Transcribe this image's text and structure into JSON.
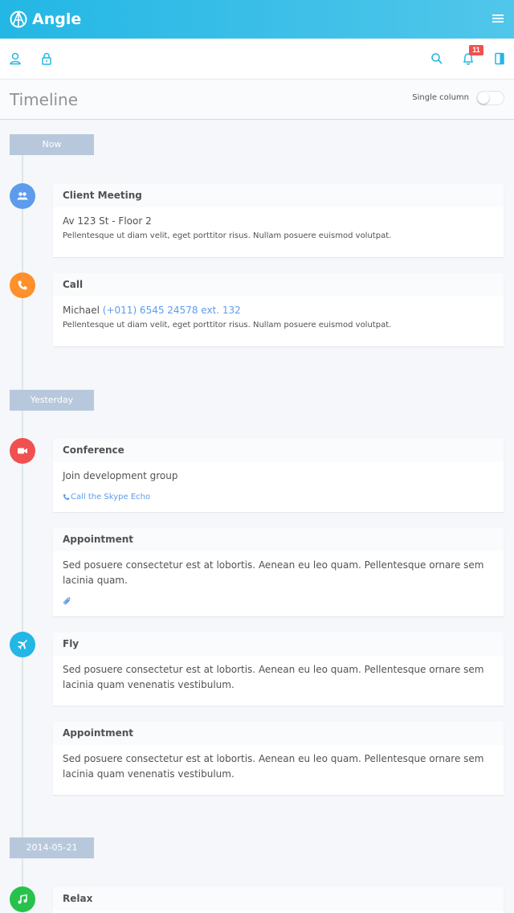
{
  "app": {
    "name": "Angle"
  },
  "notifications": {
    "count": "11"
  },
  "page": {
    "title": "Timeline",
    "toggle_label": "Single column"
  },
  "colors": {
    "primary": "#23b7e5",
    "blue": "#5d9cec",
    "orange": "#ff902b",
    "red": "#f05050",
    "sky": "#23b7e5",
    "green": "#27c24c",
    "separator": "#b8c8dc"
  },
  "separators": [
    "Now",
    "Yesterday",
    "2014-05-21"
  ],
  "events": [
    {
      "icon": "users-icon",
      "title": "Client Meeting",
      "subtitle": "Av 123 St - Floor 2",
      "text": "Pellentesque ut diam velit, eget porttitor risus. Nullam posuere euismod volutpat."
    },
    {
      "icon": "phone-icon",
      "title": "Call",
      "caller": "Michael",
      "phone": "(+011) 6545 24578 ext. 132",
      "text": "Pellentesque ut diam velit, eget porttitor risus. Nullam posuere euismod volutpat."
    },
    {
      "icon": "video-icon",
      "title": "Conference",
      "subtitle": "Join development group",
      "link": "Call the Skype Echo"
    },
    {
      "title": "Appointment",
      "text": "Sed posuere consectetur est at lobortis. Aenean eu leo quam. Pellentesque ornare sem lacinia quam.",
      "attachment_icon": "paperclip-icon"
    },
    {
      "icon": "plane-icon",
      "title": "Fly",
      "text": "Sed posuere consectetur est at lobortis. Aenean eu leo quam. Pellentesque ornare sem lacinia quam venenatis vestibulum."
    },
    {
      "title": "Appointment",
      "text": "Sed posuere consectetur est at lobortis. Aenean eu leo quam. Pellentesque ornare sem lacinia quam venenatis vestibulum."
    },
    {
      "icon": "music-icon",
      "title": "Relax"
    }
  ]
}
